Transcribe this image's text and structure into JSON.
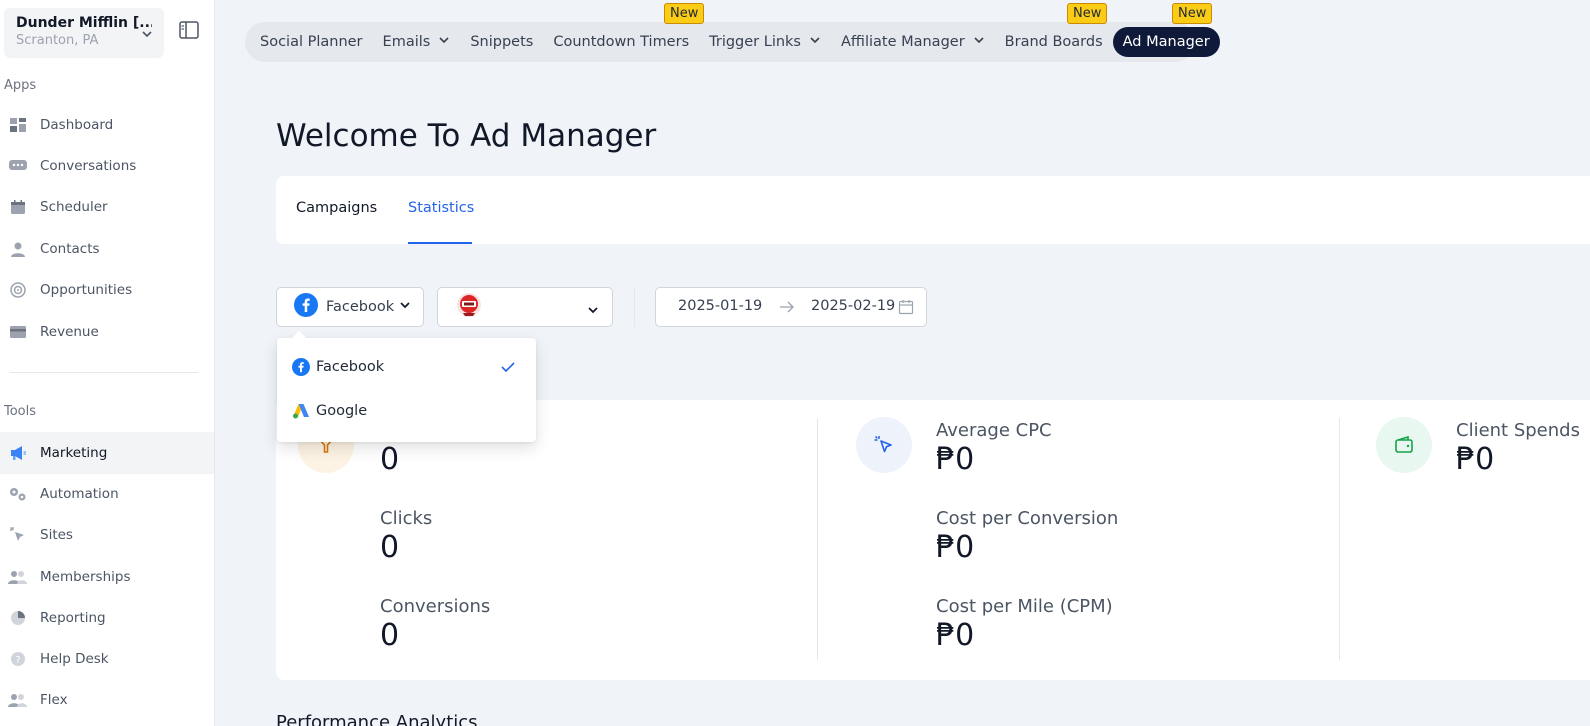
{
  "location": {
    "name": "Dunder Mifflin [...",
    "address": "Scranton, PA"
  },
  "sidebar": {
    "apps_label": "Apps",
    "apps": [
      {
        "label": "Dashboard",
        "icon": "dashboard-icon"
      },
      {
        "label": "Conversations",
        "icon": "chat-icon"
      },
      {
        "label": "Scheduler",
        "icon": "calendar-icon"
      },
      {
        "label": "Contacts",
        "icon": "person-icon"
      },
      {
        "label": "Opportunities",
        "icon": "target-icon"
      },
      {
        "label": "Revenue",
        "icon": "card-icon"
      }
    ],
    "tools_label": "Tools",
    "tools": [
      {
        "label": "Marketing",
        "icon": "megaphone-icon",
        "active": true
      },
      {
        "label": "Automation",
        "icon": "gears-icon"
      },
      {
        "label": "Sites",
        "icon": "cursor-click-icon"
      },
      {
        "label": "Memberships",
        "icon": "users-icon"
      },
      {
        "label": "Reporting",
        "icon": "pie-icon"
      },
      {
        "label": "Help Desk",
        "icon": "help-icon"
      },
      {
        "label": "Flex",
        "icon": "users-icon"
      }
    ]
  },
  "topnav": {
    "items": [
      {
        "label": "Social Planner",
        "has_dropdown": false
      },
      {
        "label": "Emails",
        "has_dropdown": true
      },
      {
        "label": "Snippets",
        "has_dropdown": false
      },
      {
        "label": "Countdown Timers",
        "has_dropdown": false,
        "badge": "New"
      },
      {
        "label": "Trigger Links",
        "has_dropdown": true
      },
      {
        "label": "Affiliate Manager",
        "has_dropdown": true
      },
      {
        "label": "Brand Boards",
        "has_dropdown": false,
        "badge": "New"
      },
      {
        "label": "Ad Manager",
        "has_dropdown": false,
        "badge": "New",
        "active": true
      }
    ]
  },
  "page": {
    "title": "Welcome To Ad Manager"
  },
  "tabs": {
    "campaigns": "Campaigns",
    "statistics": "Statistics",
    "active": "statistics"
  },
  "filters": {
    "platform": "Facebook",
    "date_start": "2025-01-19",
    "date_end": "2025-02-19"
  },
  "platform_dropdown": {
    "options": [
      {
        "label": "Facebook",
        "icon": "facebook-icon",
        "selected": true
      },
      {
        "label": "Google",
        "icon": "google-ads-icon",
        "selected": false
      }
    ]
  },
  "stats": {
    "clicks_label": "Clicks",
    "conversions_label": "Conversions",
    "avg_cpc_label": "Average CPC",
    "cost_per_conversion_label": "Cost per Conversion",
    "cpm_label": "Cost per Mile (CPM)",
    "client_spends_label": "Client Spends",
    "impressions_value": "0",
    "clicks_value": "0",
    "conversions_value": "0",
    "avg_cpc_value": "₱0",
    "cost_per_conversion_value": "₱0",
    "cpm_value": "₱0",
    "client_spends_value": "₱0"
  },
  "performance": {
    "heading": "Performance Analytics"
  },
  "colors": {
    "accent": "#2563eb",
    "active_tab_bg": "#0f1a3a",
    "badge": "#facc15"
  }
}
